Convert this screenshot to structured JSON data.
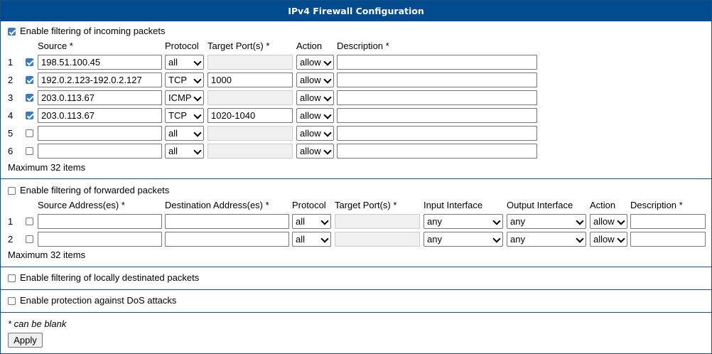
{
  "title": "IPv4 Firewall Configuration",
  "incoming": {
    "enable_label": "Enable filtering of incoming packets",
    "enabled": true,
    "headers": {
      "source": "Source *",
      "protocol": "Protocol",
      "target": "Target Port(s) *",
      "action": "Action",
      "description": "Description *"
    },
    "rows": [
      {
        "num": "1",
        "checked": true,
        "source": "198.51.100.45",
        "protocol": "all",
        "target": "",
        "action": "allow",
        "description": ""
      },
      {
        "num": "2",
        "checked": true,
        "source": "192.0.2.123-192.0.2.127",
        "protocol": "TCP",
        "target": "1000",
        "action": "allow",
        "description": ""
      },
      {
        "num": "3",
        "checked": true,
        "source": "203.0.113.67",
        "protocol": "ICMP",
        "target": "",
        "action": "allow",
        "description": ""
      },
      {
        "num": "4",
        "checked": true,
        "source": "203.0.113.67",
        "protocol": "TCP",
        "target": "1020-1040",
        "action": "allow",
        "description": ""
      },
      {
        "num": "5",
        "checked": false,
        "source": "",
        "protocol": "all",
        "target": "",
        "action": "allow",
        "description": ""
      },
      {
        "num": "6",
        "checked": false,
        "source": "",
        "protocol": "all",
        "target": "",
        "action": "allow",
        "description": ""
      }
    ],
    "max_note": "Maximum 32 items"
  },
  "forwarded": {
    "enable_label": "Enable filtering of forwarded packets",
    "enabled": false,
    "headers": {
      "source": "Source Address(es) *",
      "destination": "Destination Address(es) *",
      "protocol": "Protocol",
      "target": "Target Port(s) *",
      "input": "Input Interface",
      "output": "Output Interface",
      "action": "Action",
      "description": "Description *"
    },
    "rows": [
      {
        "num": "1",
        "checked": false,
        "source": "",
        "destination": "",
        "protocol": "all",
        "target": "",
        "input": "any",
        "output": "any",
        "action": "allow",
        "description": ""
      },
      {
        "num": "2",
        "checked": false,
        "source": "",
        "destination": "",
        "protocol": "all",
        "target": "",
        "input": "any",
        "output": "any",
        "action": "allow",
        "description": ""
      }
    ],
    "max_note": "Maximum 32 items"
  },
  "local": {
    "enable_label": "Enable filtering of locally destinated packets",
    "enabled": false
  },
  "dos": {
    "enable_label": "Enable protection against DoS attacks",
    "enabled": false
  },
  "footer": {
    "note": "* can be blank",
    "apply_label": "Apply"
  }
}
